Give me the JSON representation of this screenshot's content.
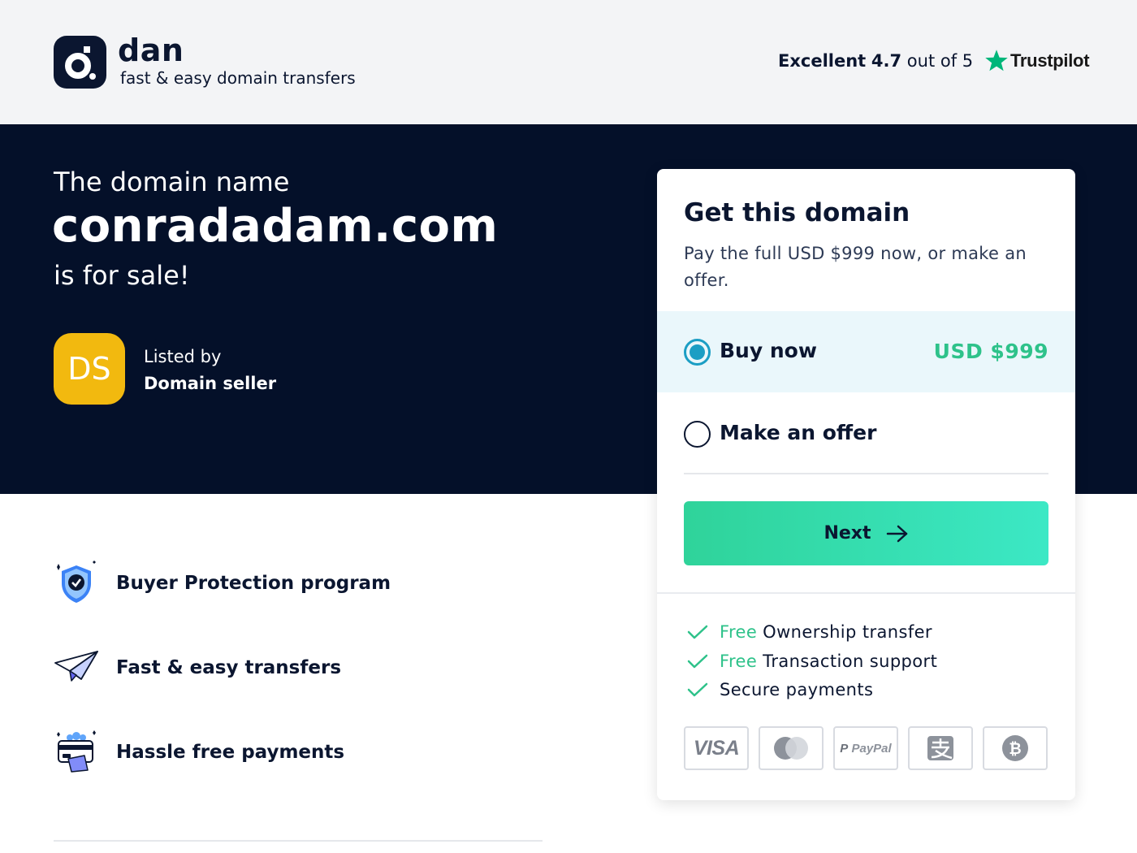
{
  "header": {
    "brand_name": "dan",
    "brand_tagline": "fast & easy domain transfers",
    "rating_label": "Excellent",
    "rating_value": "4.7",
    "rating_suffix": "out of 5",
    "trustpilot_label": "Trustpilot"
  },
  "hero": {
    "pre_text": "The domain name",
    "domain": "conradadam.com",
    "post_text": "is for sale!",
    "avatar_initials": "DS",
    "listed_by_label": "Listed by",
    "seller_name": "Domain seller"
  },
  "features": [
    {
      "label": "Buyer Protection program",
      "icon": "shield-check-icon"
    },
    {
      "label": "Fast & easy transfers",
      "icon": "paper-plane-icon"
    },
    {
      "label": "Hassle free payments",
      "icon": "card-payment-icon"
    }
  ],
  "card": {
    "title": "Get this domain",
    "subtitle": "Pay the full USD $999 now, or make an offer.",
    "options": [
      {
        "label": "Buy now",
        "price": "USD $999",
        "selected": true
      },
      {
        "label": "Make an offer",
        "selected": false
      }
    ],
    "next_label": "Next",
    "perks": [
      {
        "free": "Free",
        "text": "Ownership transfer"
      },
      {
        "free": "Free",
        "text": "Transaction support"
      },
      {
        "free": "",
        "text": "Secure payments"
      }
    ],
    "payment_methods": [
      "visa-icon",
      "mastercard-icon",
      "paypal-icon",
      "alipay-icon",
      "bitcoin-icon"
    ],
    "payment_labels": {
      "visa": "VISA",
      "paypal": "PayPal"
    }
  },
  "colors": {
    "navy": "#041029",
    "accent_green": "#2ec28a",
    "radio_blue": "#1b9ec4",
    "avatar_yellow": "#f2b90f",
    "trustpilot_green": "#00b67a"
  }
}
